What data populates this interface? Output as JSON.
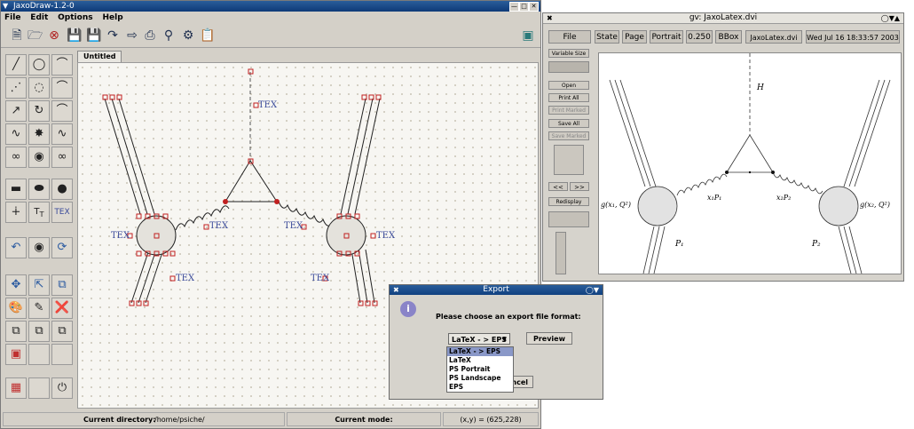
{
  "jaxodraw": {
    "title": "JaxoDraw-1.2-0",
    "menu": [
      "File",
      "Edit",
      "Options",
      "Help"
    ],
    "tab": "Untitled",
    "canvas_tex": "TEX",
    "status": {
      "directory_label": "Current directory:",
      "directory_value": "/home/psiche/",
      "mode_label": "Current mode:",
      "coords": "(x,y) = (625,228)"
    },
    "toolbar_icons": [
      "new-file-icon",
      "open-icon",
      "close-icon",
      "save-icon",
      "save-as-icon",
      "export-icon",
      "import-icon",
      "print-icon",
      "preview-icon",
      "settings-icon",
      "clipboard-icon"
    ],
    "palette_icons": [
      "line-icon",
      "circle-icon",
      "arc-icon",
      "dashed-line-icon",
      "dashed-circle-icon",
      "dashed-arc-icon",
      "arrow-line-icon",
      "arrow-circle-icon",
      "arrow-arc-icon",
      "photon-line-icon",
      "photon-loop-icon",
      "photon-arc-icon",
      "gluon-line-icon",
      "gluon-loop-icon",
      "gluon-arc-icon",
      "box-icon",
      "blob-icon",
      "vertex-icon",
      "zigzag-icon",
      "text-icon",
      "latex-text-icon",
      "undo-icon",
      "group-icon",
      "refresh-icon",
      "move-icon",
      "resize-icon",
      "copy-icon",
      "color-icon",
      "edit-icon",
      "delete-icon",
      "duplicate-icon",
      "ungroup-icon",
      "front-back-icon",
      "select-icon",
      "grid-icon",
      "quit-icon"
    ]
  },
  "gv": {
    "title": "gv: JaxoLatex.dvi",
    "buttons": {
      "file": "File",
      "state": "State",
      "page": "Page",
      "orientation": "Portrait",
      "scale": "0.250",
      "bbox": "BBox",
      "filename": "JaxoLatex.dvi",
      "date": "Wed Jul 16 18:33:57 2003"
    },
    "side": {
      "variable_size": "Variable Size",
      "open": "Open",
      "print_all": "Print All",
      "print_marked": "Print Marked",
      "save_all": "Save All",
      "save_marked": "Save Marked",
      "prev": "<<",
      "next": ">>",
      "redisplay": "Redisplay"
    },
    "labels": {
      "h": "H",
      "g_left": "g(x₁, Q²)",
      "g_right": "g(x₂, Q²)",
      "x1p1": "x₁P₁",
      "x2p2": "x₂P₂",
      "p1": "P₁",
      "p2": "P₂"
    }
  },
  "export": {
    "title": "Export",
    "message": "Please choose an export file format:",
    "selected": "LaTeX - > EPS",
    "options": [
      "LaTeX - > EPS",
      "LaTeX",
      "PS Portrait",
      "PS Landscape",
      "EPS"
    ],
    "preview_label": "Preview",
    "cancel_label": "ancel"
  }
}
